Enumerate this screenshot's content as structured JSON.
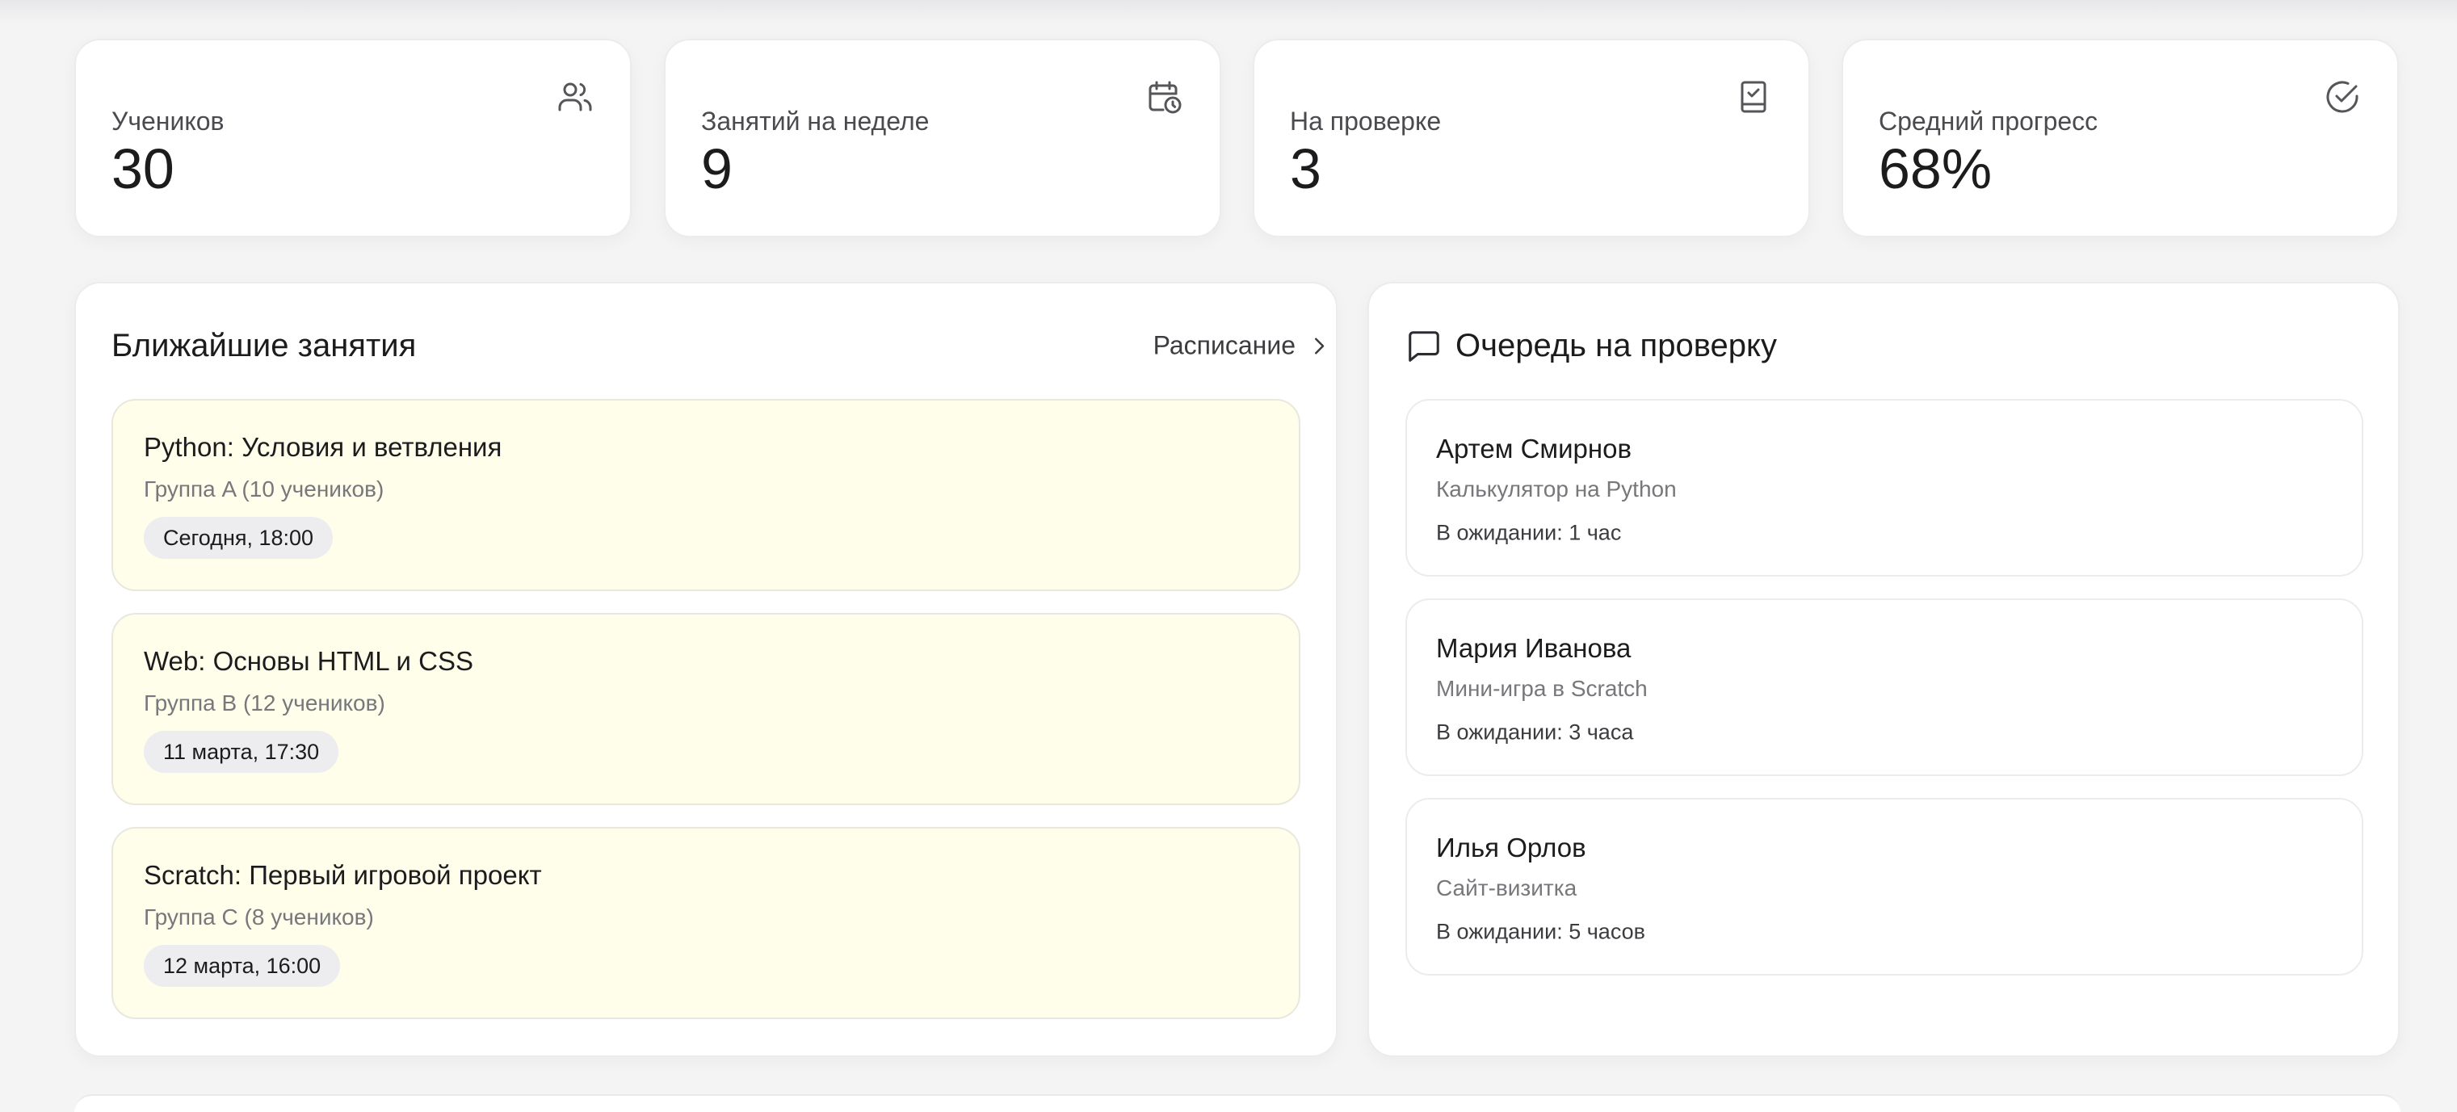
{
  "stats": [
    {
      "label": "Учеников",
      "value": "30",
      "icon": "users-icon"
    },
    {
      "label": "Занятий на неделе",
      "value": "9",
      "icon": "calendar-clock-icon"
    },
    {
      "label": "На проверке",
      "value": "3",
      "icon": "clipboard-check-icon"
    },
    {
      "label": "Средний прогресс",
      "value": "68%",
      "icon": "circle-check-icon"
    }
  ],
  "upcoming": {
    "title": "Ближайшие занятия",
    "schedule_link": "Расписание",
    "lessons": [
      {
        "title": "Python: Условия и ветвления",
        "group": "Группа A (10 учеников)",
        "time": "Сегодня, 18:00"
      },
      {
        "title": "Web: Основы HTML и CSS",
        "group": "Группа B (12 учеников)",
        "time": "11 марта, 17:30"
      },
      {
        "title": "Scratch: Первый игровой проект",
        "group": "Группа C (8 учеников)",
        "time": "12 марта, 16:00"
      }
    ]
  },
  "review_queue": {
    "title": "Очередь на проверку",
    "items": [
      {
        "name": "Артем Смирнов",
        "project": "Калькулятор на Python",
        "waiting": "В ожидании: 1 час"
      },
      {
        "name": "Мария Иванова",
        "project": "Мини-игра в Scratch",
        "waiting": "В ожидании: 3 часа"
      },
      {
        "name": "Илья Орлов",
        "project": "Сайт-визитка",
        "waiting": "В ожидании: 5 часов"
      }
    ]
  },
  "colors": {
    "background": "#f4f4f5",
    "card": "#ffffff",
    "lesson_card": "#fefeea",
    "time_chip": "#ededf0",
    "text_primary": "#1c1c1e",
    "text_secondary": "#77777c"
  }
}
